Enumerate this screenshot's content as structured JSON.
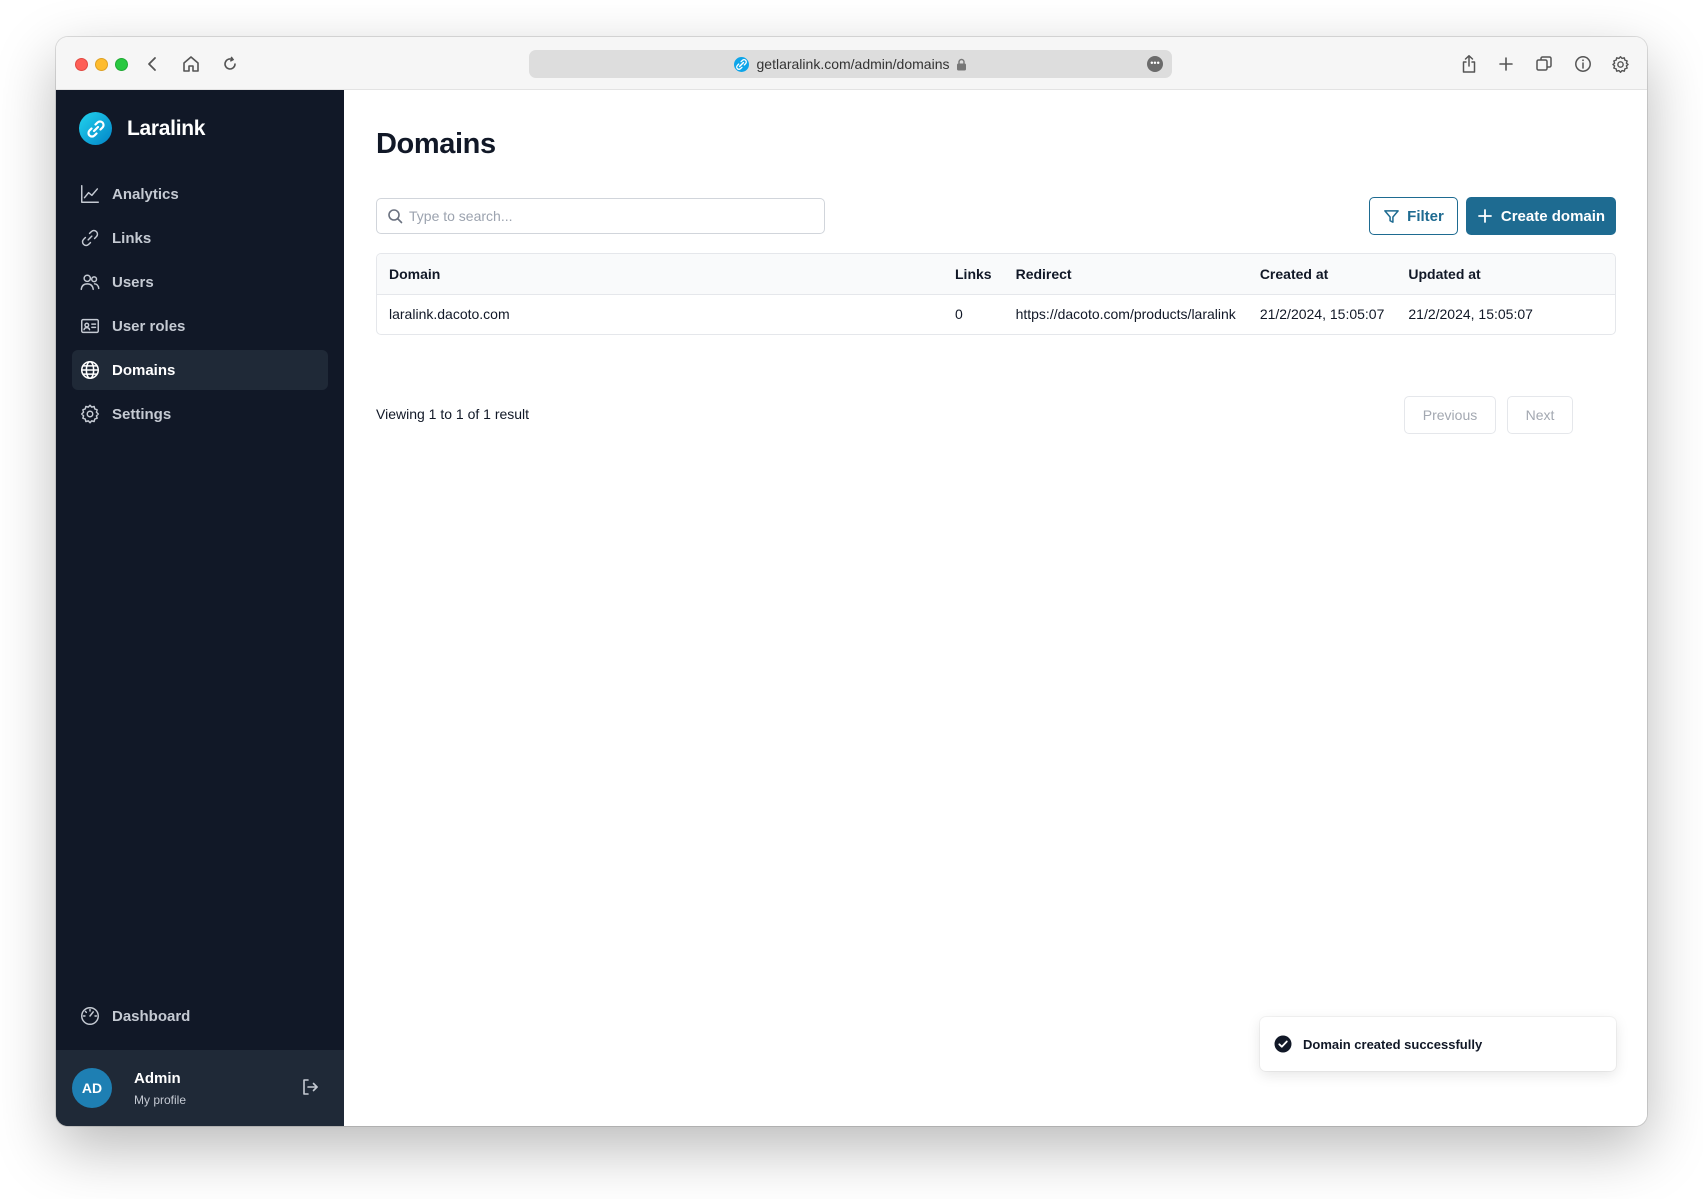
{
  "browser": {
    "url": "getlaralink.com/admin/domains",
    "icons": [
      "back-icon",
      "home-icon",
      "reload-icon",
      "share-icon",
      "new-tab-icon",
      "tabs-icon",
      "info-icon",
      "gear-icon"
    ]
  },
  "sidebar": {
    "brand": "Laralink",
    "items": [
      {
        "label": "Analytics",
        "icon": "chart-icon",
        "active": false
      },
      {
        "label": "Links",
        "icon": "link-icon",
        "active": false
      },
      {
        "label": "Users",
        "icon": "users-icon",
        "active": false
      },
      {
        "label": "User roles",
        "icon": "id-card-icon",
        "active": false
      },
      {
        "label": "Domains",
        "icon": "globe-icon",
        "active": true
      },
      {
        "label": "Settings",
        "icon": "gear-icon",
        "active": false
      }
    ],
    "bottom_item": {
      "label": "Dashboard",
      "icon": "gauge-icon"
    },
    "profile": {
      "initials": "AD",
      "name": "Admin",
      "subtitle": "My profile"
    }
  },
  "main": {
    "title": "Domains",
    "search_placeholder": "Type to search...",
    "filter_label": "Filter",
    "create_label": "Create domain",
    "table": {
      "columns": [
        "Domain",
        "Links",
        "Redirect",
        "Created at",
        "Updated at"
      ],
      "rows": [
        [
          "laralink.dacoto.com",
          "0",
          "https://dacoto.com/products/laralink",
          "21/2/2024, 15:05:07",
          "21/2/2024, 15:05:07"
        ]
      ]
    },
    "pagination": {
      "summary": "Viewing 1 to 1 of 1 result",
      "previous": "Previous",
      "next": "Next"
    }
  },
  "toast": {
    "message": "Domain created successfully",
    "icon": "check-circle-icon"
  },
  "colors": {
    "sidebar_bg": "#111827",
    "accent": "#1e6b91",
    "active_item_bg": "#1f2937"
  }
}
